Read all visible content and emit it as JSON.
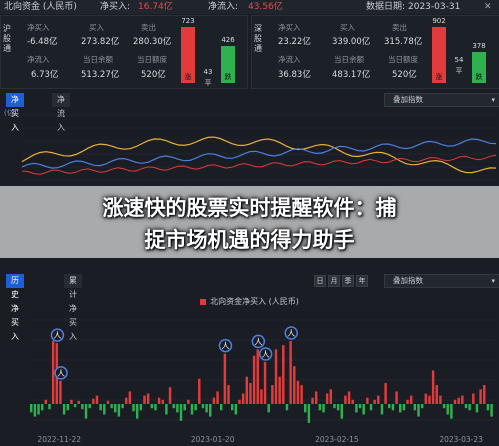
{
  "header": {
    "title": "北向资金 (人民币)",
    "net_buy_label": "净买入:",
    "net_buy_value": "16.74亿",
    "net_inflow_label": "净流入:",
    "net_inflow_value": "43.56亿",
    "date_label": "数据日期:",
    "date_value": "2023-03-31"
  },
  "panels": [
    {
      "label": "沪股通",
      "net_buy_label": "净买入",
      "net_buy_value": "-6.48亿",
      "buy_label": "买入",
      "buy_value": "273.82亿",
      "sell_label": "卖出",
      "sell_value": "280.30亿",
      "net_inflow_label": "净流入",
      "net_inflow_value": "6.73亿",
      "balance_label": "当日余额",
      "balance_value": "513.27亿",
      "quota_label": "当日额度",
      "quota_value": "520亿",
      "up_count": "723",
      "flat_count": "43",
      "down_count": "426",
      "up_label": "涨",
      "flat_label": "平",
      "down_label": "跌"
    },
    {
      "label": "深股通",
      "net_buy_label": "净买入",
      "net_buy_value": "23.22亿",
      "buy_label": "买入",
      "buy_value": "339.00亿",
      "sell_label": "卖出",
      "sell_value": "315.78亿",
      "net_inflow_label": "净流入",
      "net_inflow_value": "36.83亿",
      "balance_label": "当日余额",
      "balance_value": "483.17亿",
      "quota_label": "当日额度",
      "quota_value": "520亿",
      "up_count": "902",
      "flat_count": "54",
      "down_count": "378",
      "up_label": "涨",
      "flat_label": "平",
      "down_label": "跌"
    }
  ],
  "tabs_top": [
    "净买入",
    "净流入"
  ],
  "dropdown_label": "叠加指数",
  "y_unit": "(亿)",
  "headline_line1": "涨速快的股票实时提醒软件：捕",
  "headline_line2": "捉市场机遇的得力助手",
  "tabs_bottom": [
    "历史净买入",
    "累计净买入"
  ],
  "period_buttons": [
    "日",
    "月",
    "季",
    "年"
  ],
  "legend_label": "北向资金净买入 (人民币)",
  "x_ticks": [
    "2022-11-22",
    "2023-01-20",
    "2023-02-15",
    "2023-03-23"
  ],
  "colors": {
    "accent": "#1f5fd6",
    "up": "#e33b3b",
    "down": "#2fb14f",
    "line_index": "#e8b23a",
    "line_flow": "#4d7fe0"
  },
  "chart_data": {
    "type": "bar",
    "series": [
      {
        "name": "北向资金净买入 (人民币)",
        "values": [
          -8,
          -12,
          -10,
          -6,
          4,
          -5,
          60,
          58,
          22,
          -10,
          -6,
          4,
          -3,
          3,
          -5,
          -14,
          -4,
          5,
          8,
          -6,
          -10,
          3,
          -4,
          -8,
          -12,
          -4,
          6,
          12,
          -7,
          -14,
          -6,
          8,
          10,
          -4,
          -6,
          6,
          4,
          -10,
          16,
          -4,
          -8,
          -16,
          -6,
          4,
          -10,
          -6,
          24,
          -4,
          -8,
          -12,
          6,
          12,
          -6,
          48,
          18,
          -6,
          -10,
          4,
          10,
          26,
          20,
          46,
          52,
          14,
          40,
          -8,
          18,
          52,
          26,
          56,
          -6,
          60,
          36,
          22,
          18,
          -8,
          -18,
          6,
          12,
          -6,
          -8,
          10,
          14,
          -4,
          -6,
          -14,
          8,
          12,
          4,
          -8,
          -4,
          -10,
          6,
          -6,
          4,
          8,
          -10,
          20,
          -4,
          -6,
          12,
          -8,
          -6,
          4,
          8,
          -6,
          -12,
          -4,
          10,
          8,
          32,
          18,
          8,
          -4,
          -10,
          -14,
          4,
          6,
          8,
          -4,
          -6,
          10,
          -8,
          14,
          18,
          -6,
          -12
        ]
      }
    ],
    "markers": [
      7,
      8,
      53,
      62,
      64,
      71
    ]
  }
}
